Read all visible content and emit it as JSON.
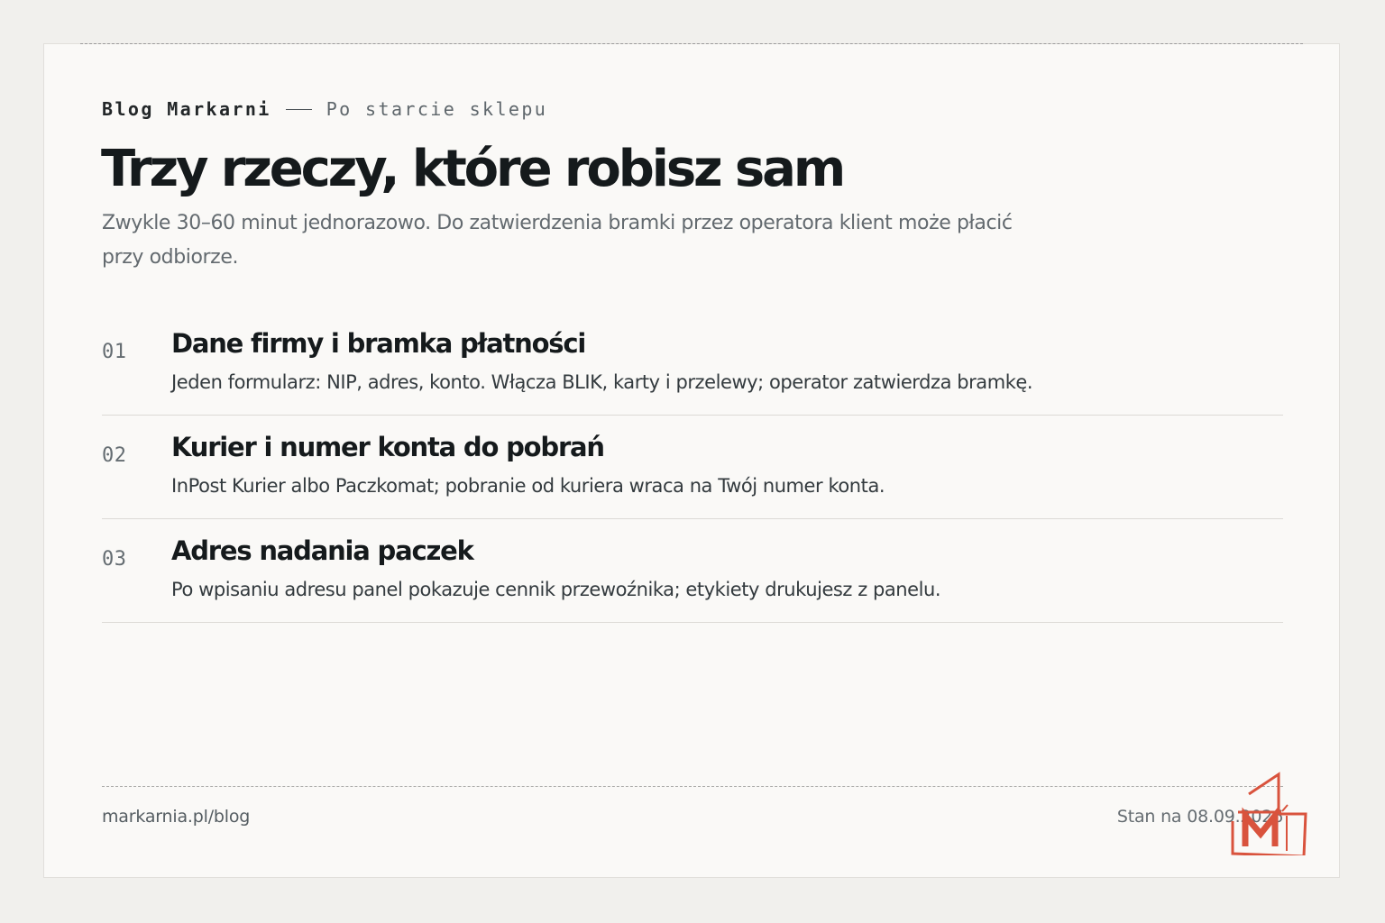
{
  "header": {
    "brand": "Blog Markarni",
    "section": "Po starcie sklepu"
  },
  "title": "Trzy rzeczy, które robisz sam",
  "lead": "Zwykle 30–60 minut jednorazowo. Do zatwierdzenia bramki przez operatora klient może płacić przy odbiorze.",
  "steps": [
    {
      "number": "01",
      "title": "Dane firmy i bramka płatności",
      "description": "Jeden formularz: NIP, adres, konto. Włącza BLIK, karty i przelewy; operator zatwierdza bramkę."
    },
    {
      "number": "02",
      "title": "Kurier i numer konta do pobrań",
      "description": "InPost Kurier albo Paczkomat; pobranie od kuriera wraca na Twój numer konta."
    },
    {
      "number": "03",
      "title": "Adres nadania paczek",
      "description": "Po wpisaniu adresu panel pokazuje cennik przewoźnika; etykiety drukujesz z panelu."
    }
  ],
  "footer": {
    "url": "markarnia.pl/blog",
    "status": "Stan na 08.09.2026"
  },
  "logo": {
    "icon": "markarnia-m-logo",
    "color": "#d9533d"
  },
  "colors": {
    "background": "#f1f0ed",
    "card": "#faf9f7",
    "text": "#151a1c",
    "muted": "#636a6f",
    "accent": "#d9533d"
  }
}
